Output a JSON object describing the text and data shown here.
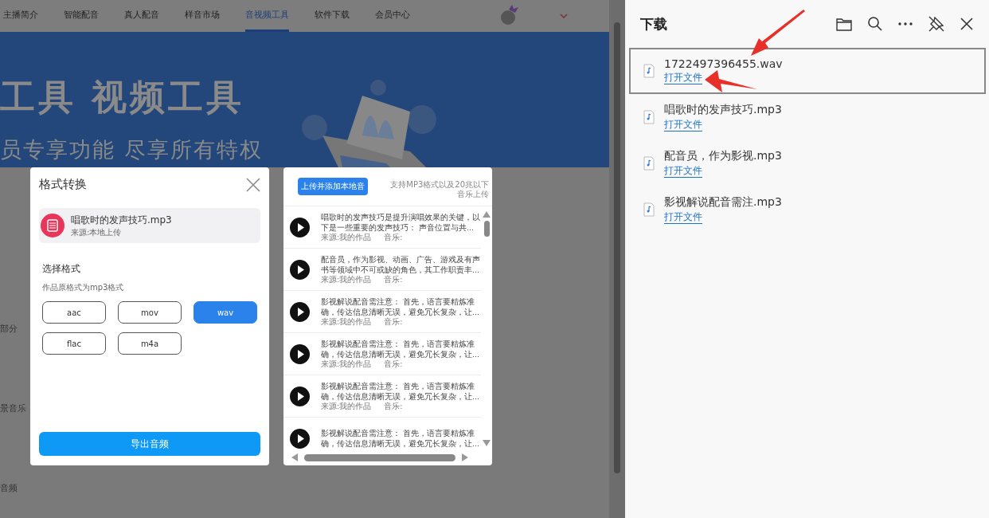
{
  "nav": {
    "items": [
      {
        "label": "主播简介",
        "selected": false
      },
      {
        "label": "智能配音",
        "selected": false
      },
      {
        "label": "真人配音",
        "selected": false
      },
      {
        "label": "样音市场",
        "selected": false
      },
      {
        "label": "音视频工具",
        "selected": true
      },
      {
        "label": "软件下载",
        "selected": false
      },
      {
        "label": "会员中心",
        "selected": false
      }
    ]
  },
  "banner": {
    "title": "工具 视频工具",
    "subtitle": "员专享功能 尽享所有特权"
  },
  "side_labels": [
    "部分",
    "景音乐",
    "音频"
  ],
  "format_dialog": {
    "title": "格式转换",
    "file": {
      "name": "唱歌时的发声技巧.mp3",
      "source": "来源:本地上传"
    },
    "section_title": "选择格式",
    "hint": "作品原格式为mp3格式",
    "formats": [
      {
        "label": "aac",
        "selected": false
      },
      {
        "label": "mov",
        "selected": false
      },
      {
        "label": "wav",
        "selected": true
      },
      {
        "label": "flac",
        "selected": false
      },
      {
        "label": "m4a",
        "selected": false
      }
    ],
    "export_button": "导出音频"
  },
  "audio_list": {
    "upload_button": "上传并添加本地音",
    "hint": "支持MP3格式以及20兆以下音乐上传",
    "items": [
      {
        "text": "唱歌时的发声技巧是提升演唱效果的关键，以下是一些重要的发声技巧：  声音位置与共...",
        "source": "来源:我的作品",
        "music": "音乐:"
      },
      {
        "text": "配音员，作为影视、动画、广告、游戏及有声书等领域中不可或缺的角色，其工作职责丰...",
        "source": "来源:我的作品",
        "music": "音乐:"
      },
      {
        "text": "影视解说配音需注意：  首先，语言要精炼准确，传达信息清晰无误，避免冗长复杂，让...",
        "source": "来源:我的作品",
        "music": "音乐:"
      },
      {
        "text": "影视解说配音需注意：  首先，语言要精炼准确，传达信息清晰无误，避免冗长复杂，让...",
        "source": "来源:我的作品",
        "music": "音乐:"
      },
      {
        "text": "影视解说配音需注意：  首先，语言要精炼准确，传达信息清晰无误，避免冗长复杂，让...",
        "source": "来源:我的作品",
        "music": "音乐:"
      },
      {
        "text": "影视解说配音需注意：  首先，语言要精炼准确，传达信息清晰无误，避免冗长复杂，让..."
      }
    ]
  },
  "downloads": {
    "title": "下载",
    "items": [
      {
        "name": "1722497396455.wav",
        "action": "打开文件",
        "selected": true
      },
      {
        "name": "唱歌时的发声技巧.mp3",
        "action": "打开文件",
        "selected": false
      },
      {
        "name": "配音员，作为影视.mp3",
        "action": "打开文件",
        "selected": false
      },
      {
        "name": "影视解说配音需注.mp3",
        "action": "打开文件",
        "selected": false
      }
    ]
  }
}
